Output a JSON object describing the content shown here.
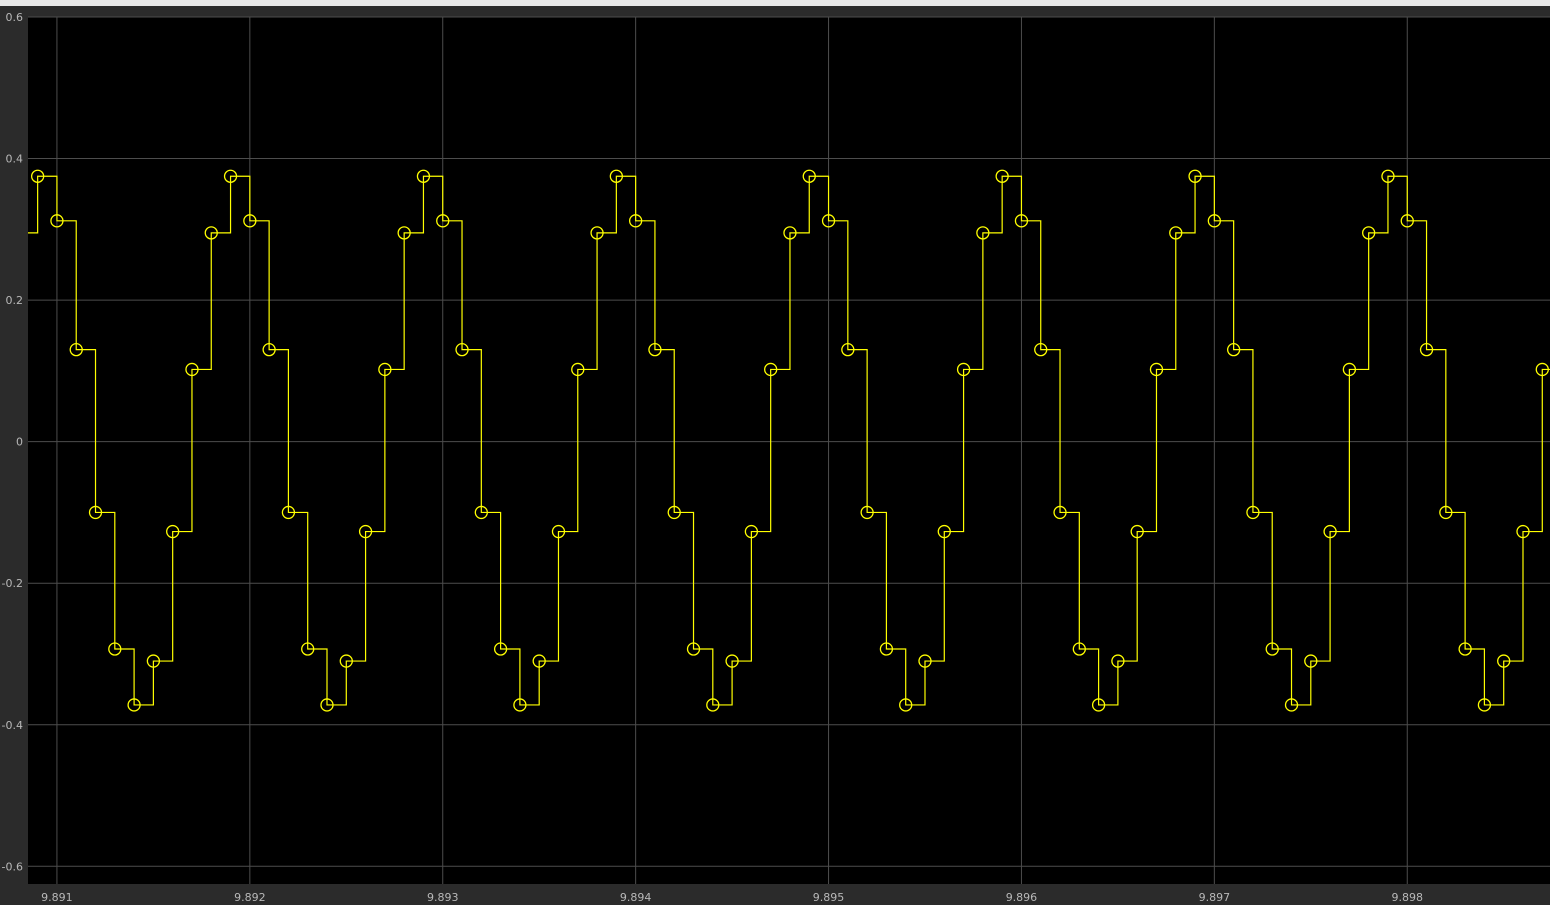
{
  "colors": {
    "background": "#000000",
    "frame": "#2b2b2b",
    "grid": "#4d4d4d",
    "signal": "#ffff00",
    "tick_text": "#b8b8b8"
  },
  "chart_data": {
    "type": "line",
    "style": "stairs with circle markers",
    "title": "",
    "xlabel": "",
    "ylabel": "",
    "xlim": [
      9.89085,
      9.89874
    ],
    "ylim": [
      -0.625,
      0.6
    ],
    "grid": true,
    "legend": "none",
    "x_ticks": [
      "9.891",
      "9.892",
      "9.893",
      "9.894",
      "9.895",
      "9.896",
      "9.897",
      "9.898"
    ],
    "y_ticks": [
      "0.6",
      "0.4",
      "0.2",
      "0",
      "-0.2",
      "-0.4",
      "-0.6"
    ],
    "series": [
      {
        "x": [
          9.8909,
          9.891,
          9.8911,
          9.8912,
          9.8913,
          9.8914,
          9.8915,
          9.8916,
          9.8917,
          9.8918,
          9.8919,
          9.892,
          9.8921,
          9.8922,
          9.8923,
          9.8924,
          9.8925,
          9.8926,
          9.8927,
          9.8928,
          9.8929,
          9.893,
          9.8931,
          9.8932,
          9.8933,
          9.8934,
          9.8935,
          9.8936,
          9.8937,
          9.8938,
          9.8939,
          9.894,
          9.8941,
          9.8942,
          9.8943,
          9.8944,
          9.8945,
          9.8946,
          9.8947,
          9.8948,
          9.8949,
          9.895,
          9.8951,
          9.8952,
          9.8953,
          9.8954,
          9.8955,
          9.8956,
          9.8957,
          9.8958,
          9.8959,
          9.896,
          9.8961,
          9.8962,
          9.8963,
          9.8964,
          9.8965,
          9.8966,
          9.8967,
          9.8968,
          9.8969,
          9.897,
          9.8971,
          9.8972,
          9.8973,
          9.8974,
          9.8975,
          9.8976,
          9.8977,
          9.8978,
          9.8979,
          9.898,
          9.8981,
          9.8982,
          9.8983,
          9.8984,
          9.8985,
          9.8986,
          9.8987
        ],
        "y": [
          0.375,
          0.312,
          0.13,
          -0.1,
          -0.293,
          -0.372,
          -0.31,
          -0.127,
          0.102,
          0.295,
          0.375,
          0.312,
          0.13,
          -0.1,
          -0.293,
          -0.372,
          -0.31,
          -0.127,
          0.102,
          0.295,
          0.375,
          0.312,
          0.13,
          -0.1,
          -0.293,
          -0.372,
          -0.31,
          -0.127,
          0.102,
          0.295,
          0.375,
          0.312,
          0.13,
          -0.1,
          -0.293,
          -0.372,
          -0.31,
          -0.127,
          0.102,
          0.295,
          0.375,
          0.312,
          0.13,
          -0.1,
          -0.293,
          -0.372,
          -0.31,
          -0.127,
          0.102,
          0.295,
          0.375,
          0.312,
          0.13,
          -0.1,
          -0.293,
          -0.372,
          -0.31,
          -0.127,
          0.102,
          0.295,
          0.375,
          0.312,
          0.13,
          -0.1,
          -0.293,
          -0.372,
          -0.31,
          -0.127,
          0.102,
          0.295,
          0.375,
          0.312,
          0.13,
          -0.1,
          -0.293,
          -0.372,
          -0.31,
          -0.127,
          0.102
        ]
      }
    ]
  }
}
